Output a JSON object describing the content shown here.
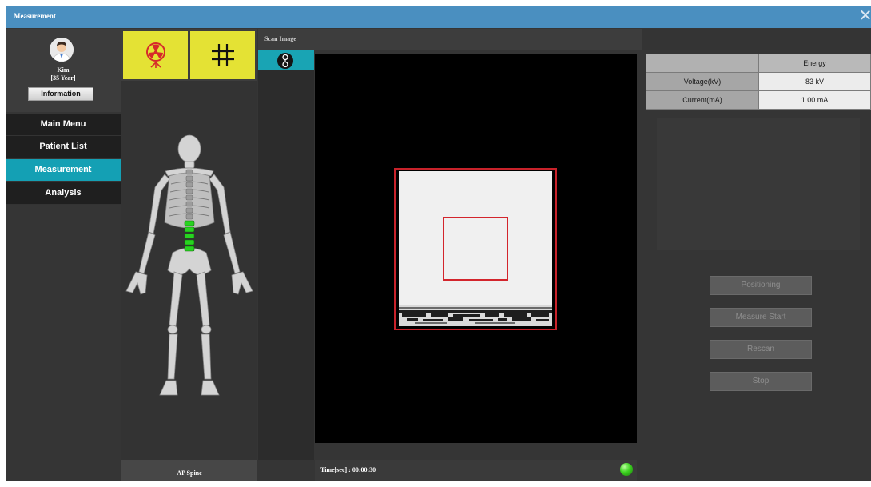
{
  "window": {
    "title": "Measurement",
    "close_glyph": "✕"
  },
  "patient": {
    "name": "Kim",
    "age": "[35 Year]",
    "info_button": "Information"
  },
  "nav": {
    "items": [
      {
        "label": "Main Menu",
        "active": false
      },
      {
        "label": "Patient List",
        "active": false
      },
      {
        "label": "Measurement",
        "active": true
      },
      {
        "label": "Analysis",
        "active": false
      }
    ]
  },
  "tools": {
    "radiation_icon": "radiation-icon",
    "grid_icon": "grid-icon"
  },
  "body_map": {
    "region_label": "AP Spine",
    "highlight_color": "#27d420"
  },
  "scan": {
    "title": "Scan Image",
    "tab_icon": "scan-device-icon",
    "time_label": "Time[sec] : 00:00:30",
    "status_led": "#3dd320"
  },
  "energy": {
    "header": "Energy",
    "rows": [
      {
        "label": "Voltage(kV)",
        "value": "83 kV"
      },
      {
        "label": "Current(mA)",
        "value": "1.00 mA"
      }
    ]
  },
  "actions": {
    "positioning": "Positioning",
    "measure_start": "Measure Start",
    "rescan": "Rescan",
    "stop": "Stop"
  },
  "colors": {
    "titlebar": "#4a8fc0",
    "accent": "#14a0b4",
    "tool_yellow": "#e4e234",
    "roi_red": "#d3252c"
  }
}
